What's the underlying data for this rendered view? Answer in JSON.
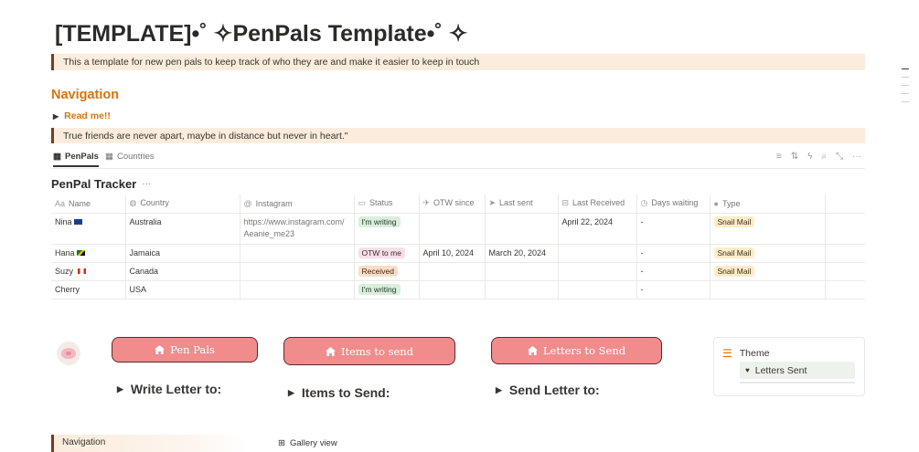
{
  "page": {
    "title": "[TEMPLATE]•˚ ✧PenPals Template•˚ ✧",
    "intro": "This a template for new pen pals to keep track of who they are and make it easier to keep in touch",
    "nav_heading": "Navigation",
    "readme_label": "Read me!!",
    "quote": "True friends are never apart, maybe in distance but never in heart.\""
  },
  "tabs": [
    {
      "label": "PenPals",
      "active": true
    },
    {
      "label": "Countries",
      "active": false
    }
  ],
  "toolbar_icons": [
    "filter-icon",
    "sort-icon",
    "automation-icon",
    "search-icon",
    "expand-icon",
    "more-icon"
  ],
  "tracker": {
    "title": "PenPal Tracker",
    "more": "···",
    "columns": [
      "Name",
      "Country",
      "Instagram",
      "Status",
      "OTW since",
      "Last sent",
      "Last Received",
      "Days waiting",
      "Type"
    ],
    "rows": [
      {
        "name": "Nina",
        "flag": "au",
        "country": "Australia",
        "instagram": "https://www.instagram.com/Aeanie_me23",
        "status": "I'm writing",
        "status_color": "green",
        "otw_since": "",
        "last_sent": "",
        "last_received": "April 22, 2024",
        "days_waiting": "-",
        "type": "Snail Mail"
      },
      {
        "name": "Hana",
        "flag": "jm",
        "country": "Jamaica",
        "instagram": "",
        "status": "OTW to me",
        "status_color": "pink",
        "otw_since": "April 10, 2024",
        "last_sent": "March 20, 2024",
        "last_received": "",
        "days_waiting": "-",
        "type": "Snail Mail"
      },
      {
        "name": "Suzy",
        "flag": "ca",
        "country": "Canada",
        "instagram": "",
        "status": "Received",
        "status_color": "orange",
        "otw_since": "",
        "last_sent": "",
        "last_received": "",
        "days_waiting": "-",
        "type": "Snail Mail"
      },
      {
        "name": "Cherry",
        "flag": "",
        "country": "USA",
        "instagram": "",
        "status": "I'm writing",
        "status_color": "green",
        "otw_since": "",
        "last_sent": "",
        "last_received": "",
        "days_waiting": "-",
        "type": ""
      }
    ]
  },
  "buttons": {
    "pen_pals": "Pen Pals",
    "items_to_send": "Items to send",
    "letters_to_send": "Letters to Send"
  },
  "toggles": {
    "write_letter": "Write Letter to:",
    "items_to_send": "Items to Send:",
    "send_letter": "Send Letter to:"
  },
  "theme": {
    "heading": "Theme",
    "item": "Letters Sent"
  },
  "bottom": {
    "nav": "Navigation",
    "gallery": "Gallery view"
  },
  "colors": {
    "accent_orange": "#d9730d",
    "callout_bg": "#fbecdd",
    "button_pink": "#f08c8c",
    "button_border": "#5b2a2a"
  }
}
